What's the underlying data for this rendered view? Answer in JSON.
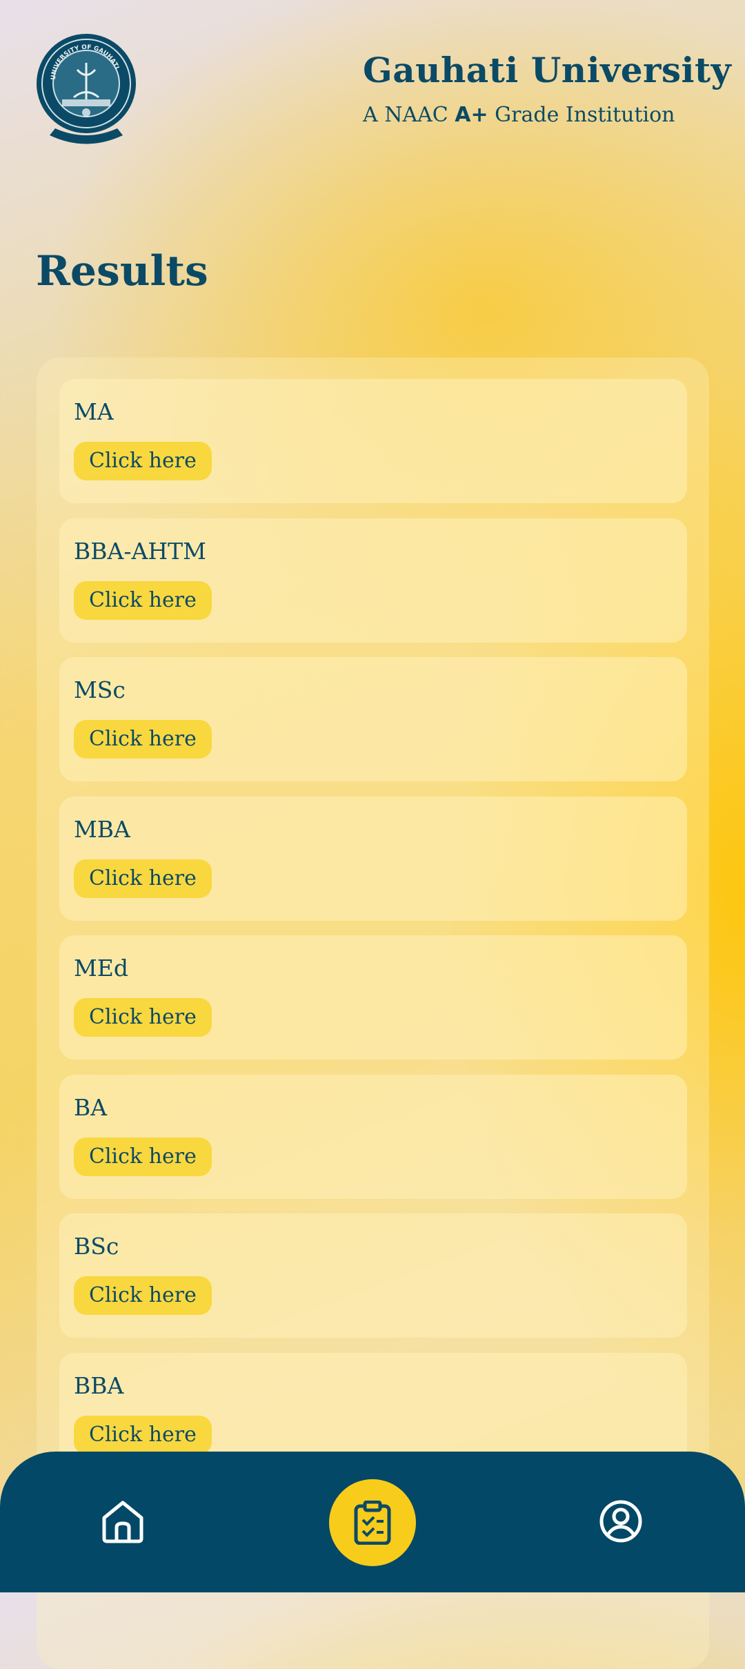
{
  "header": {
    "logo_text": "UNIVERSITY OF GAUHATI",
    "title": "Gauhati University",
    "subtitle_prefix": "A NAAC ",
    "subtitle_grade": "A+",
    "subtitle_suffix": " Grade Institution"
  },
  "page": {
    "title": "Results"
  },
  "results": [
    {
      "name": "MA",
      "button": "Click here"
    },
    {
      "name": "BBA-AHTM",
      "button": "Click here"
    },
    {
      "name": "MSc",
      "button": "Click here"
    },
    {
      "name": "MBA",
      "button": "Click here"
    },
    {
      "name": "MEd",
      "button": "Click here"
    },
    {
      "name": "BA",
      "button": "Click here"
    },
    {
      "name": "BSc",
      "button": "Click here"
    },
    {
      "name": "BBA",
      "button": "Click here"
    }
  ],
  "nav": {
    "items": [
      {
        "icon": "home-icon"
      },
      {
        "icon": "clipboard-check-icon",
        "active": true
      },
      {
        "icon": "user-circle-icon"
      }
    ]
  },
  "colors": {
    "primary": "#034867",
    "accent": "#f8cc1a",
    "text": "#0b4a66"
  }
}
